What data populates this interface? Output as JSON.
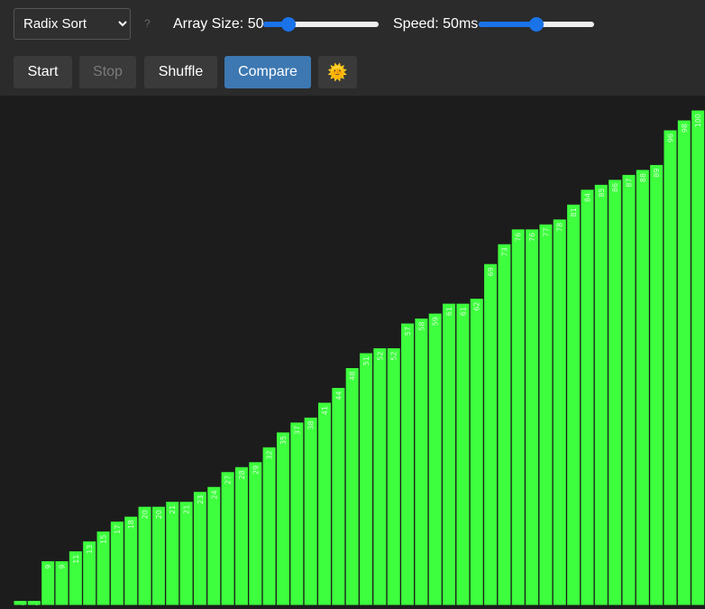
{
  "controls": {
    "algorithm": "Radix Sort",
    "help": "?",
    "array_size_label": "Array Size: 50",
    "array_size_value": 50,
    "array_size_fraction": 0.22,
    "speed_label": "Speed: 50ms",
    "speed_fraction": 0.5,
    "buttons": {
      "start": "Start",
      "stop": "Stop",
      "shuffle": "Shuffle",
      "compare": "Compare",
      "theme": "🌞"
    }
  },
  "colors": {
    "bar": "#3dff3d",
    "bar_border": "#1c1c1c",
    "bar_label": "#d6ffd6",
    "accent": "#1a73e8",
    "compare_button": "#3d78b2"
  },
  "chart_data": {
    "type": "bar",
    "max_value": 100,
    "values": [
      1,
      1,
      9,
      9,
      11,
      13,
      15,
      17,
      18,
      20,
      20,
      21,
      21,
      23,
      24,
      27,
      28,
      29,
      32,
      35,
      37,
      38,
      41,
      44,
      48,
      51,
      52,
      52,
      57,
      58,
      59,
      61,
      61,
      62,
      69,
      73,
      76,
      76,
      77,
      78,
      81,
      84,
      85,
      86,
      87,
      88,
      89,
      96,
      98,
      100
    ],
    "labels": [
      "1",
      "1",
      "9",
      "9",
      "11",
      "13",
      "15",
      "17",
      "18",
      "20",
      "20",
      "21",
      "21",
      "23",
      "24",
      "27",
      "28",
      "29",
      "32",
      "35",
      "37",
      "38",
      "41",
      "44",
      "48",
      "51",
      "52",
      "52",
      "57",
      "58",
      "59",
      "61",
      "61",
      "62",
      "69",
      "73",
      "76",
      "76",
      "77",
      "78",
      "81",
      "84",
      "85",
      "86",
      "87",
      "88",
      "89",
      "96",
      "98",
      "100"
    ]
  }
}
